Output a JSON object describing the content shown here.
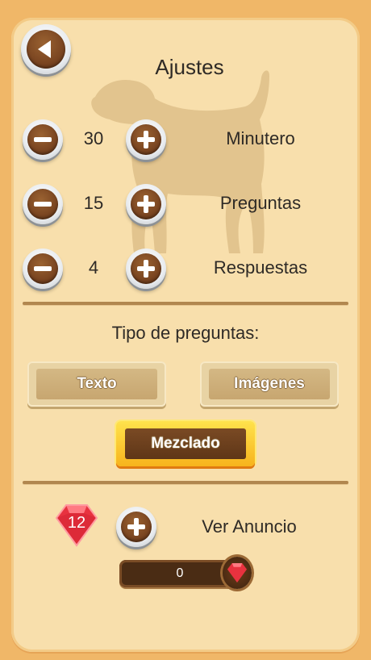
{
  "header": {
    "title": "Ajustes"
  },
  "settings": [
    {
      "value": "30",
      "label": "Minutero"
    },
    {
      "value": "15",
      "label": "Preguntas"
    },
    {
      "value": "4",
      "label": "Respuestas"
    }
  ],
  "question_type": {
    "heading": "Tipo de preguntas:",
    "options": [
      "Texto",
      "Imágenes",
      "Mezclado"
    ],
    "selected": "Mezclado"
  },
  "rewards": {
    "gems": "12",
    "ad_label": "Ver Anuncio",
    "progress_value": "0"
  },
  "colors": {
    "background": "#f0b768",
    "panel": "#f8dfac",
    "wood": "#7a4521",
    "accent": "#f7b41d",
    "gem": "#e8323f"
  },
  "icons": [
    "back-arrow-icon",
    "minus-icon",
    "plus-icon",
    "dog-silhouette-icon",
    "gem-icon"
  ]
}
